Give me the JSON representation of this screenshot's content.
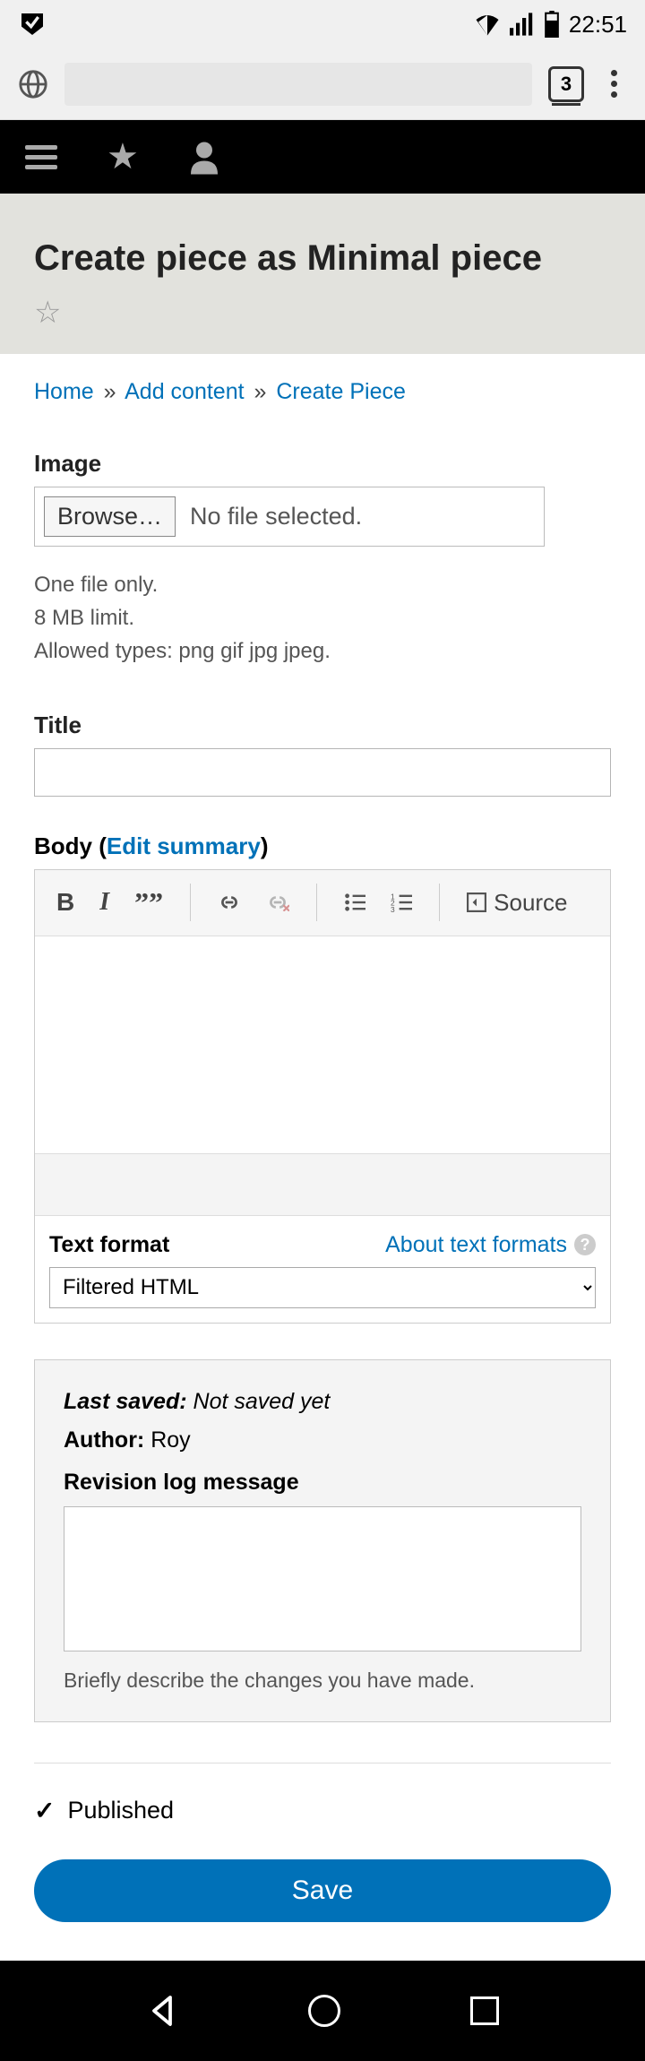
{
  "status_bar": {
    "time": "22:51"
  },
  "browser": {
    "tab_count": "3"
  },
  "page": {
    "title": "Create piece as Minimal piece"
  },
  "breadcrumbs": {
    "items": [
      "Home",
      "Add content",
      "Create Piece"
    ],
    "separator": "»"
  },
  "image_field": {
    "label": "Image",
    "browse_label": "Browse…",
    "status": "No file selected.",
    "constraint_lines": {
      "l0": "One file only.",
      "l1": "8 MB limit.",
      "l2": "Allowed types: png gif jpg jpeg."
    }
  },
  "title_field": {
    "label": "Title",
    "value": ""
  },
  "body_field": {
    "label_prefix": "Body (",
    "edit_summary": "Edit summary",
    "label_suffix": ")",
    "toolbar": {
      "bold": "B",
      "italic": "I",
      "quote": "””",
      "source": "Source"
    },
    "value": ""
  },
  "format": {
    "label": "Text format",
    "about_label": "About text formats",
    "selected": "Filtered HTML"
  },
  "revision": {
    "last_saved_key": "Last saved:",
    "last_saved_val": "Not saved yet",
    "author_key": "Author:",
    "author_val": "Roy",
    "log_label": "Revision log message",
    "log_value": "",
    "help": "Briefly describe the changes you have made."
  },
  "published": {
    "label": "Published",
    "checked": true
  },
  "buttons": {
    "save": "Save"
  }
}
